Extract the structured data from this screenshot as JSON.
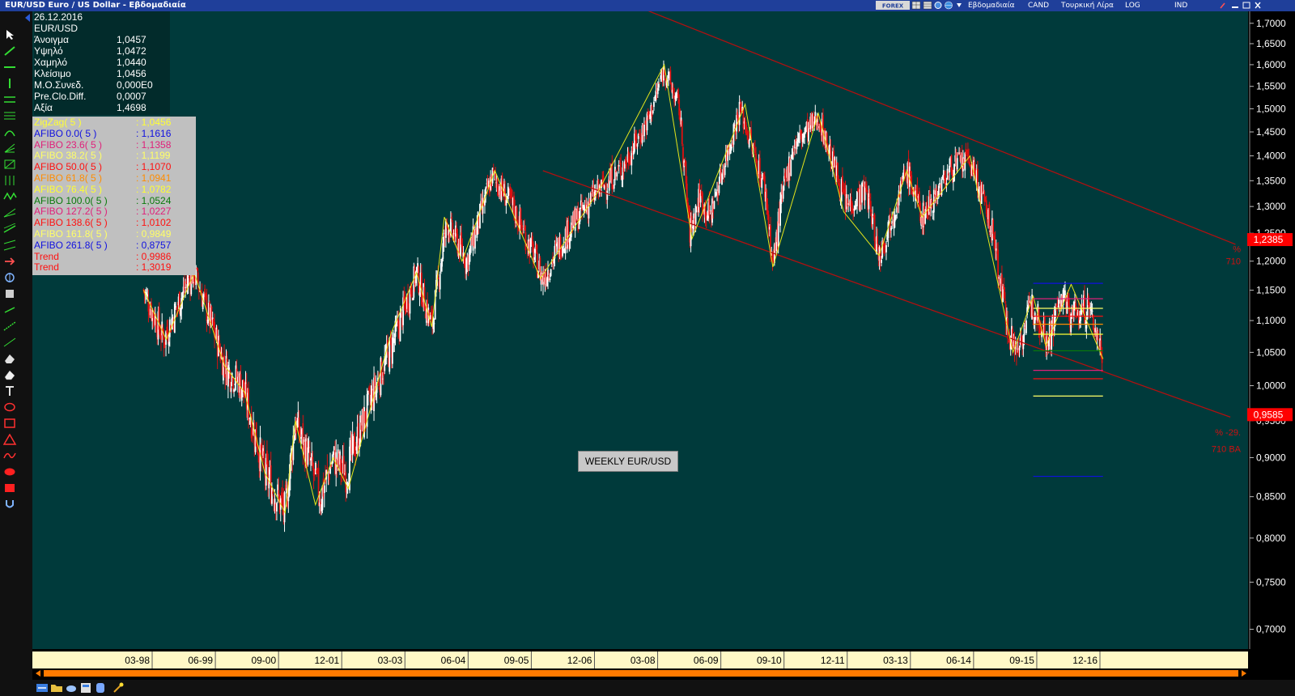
{
  "window": {
    "title": "EUR/USD Euro / US Dollar - Εβδομαδιαία",
    "options": [
      {
        "key": "period",
        "label": "Εβδομαδιαία"
      },
      {
        "key": "style",
        "label": "CAND"
      },
      {
        "key": "currency",
        "label": "Τουρκική Λίρα"
      },
      {
        "key": "scale",
        "label": "LOG"
      },
      {
        "key": "indicators",
        "label": "IND"
      }
    ],
    "brand": "FOREX"
  },
  "info": {
    "date": "26.12.2016",
    "symbol": "EUR/USD",
    "rows": [
      {
        "label": "Άνοιγμα",
        "value": "1,0457"
      },
      {
        "label": "Υψηλό",
        "value": "1,0472"
      },
      {
        "label": "Χαμηλό",
        "value": "1,0440"
      },
      {
        "label": "Κλείσιμο",
        "value": "1,0456"
      },
      {
        "label": "Μ.Ο.Συνεδ.",
        "value": "0,000E0"
      },
      {
        "label": "Pre.Clo.Diff.",
        "value": "0,0007"
      },
      {
        "label": "Αξία",
        "value": "1,4698"
      }
    ]
  },
  "indicators": [
    {
      "label": "ZigZag( 5 )",
      "value": ": 1,0456",
      "color": "#ffff33"
    },
    {
      "label": "AFIBO 0.0( 5 )",
      "value": ": 1,1616",
      "color": "#1010e0"
    },
    {
      "label": "AFIBO 23.6( 5 )",
      "value": ": 1,1358",
      "color": "#e0207a"
    },
    {
      "label": "AFIBO 38.2( 5 )",
      "value": ": 1,1199",
      "color": "#ffff66"
    },
    {
      "label": "AFIBO 50.0( 5 )",
      "value": ": 1,1070",
      "color": "#ff1010"
    },
    {
      "label": "AFIBO 61.8( 5 )",
      "value": ": 1,0941",
      "color": "#ff8c00"
    },
    {
      "label": "AFIBO 76.4( 5 )",
      "value": ": 1,0782",
      "color": "#ffff33"
    },
    {
      "label": "AFIBO 100.0( 5 )",
      "value": ": 1,0524",
      "color": "#0a7a0a"
    },
    {
      "label": "AFIBO 127.2( 5 )",
      "value": ": 1,0227",
      "color": "#e0207a"
    },
    {
      "label": "AFIBO 138.6( 5 )",
      "value": ": 1,0102",
      "color": "#ff1010"
    },
    {
      "label": "AFIBO 161.8( 5 )",
      "value": ": 0,9849",
      "color": "#ffff66"
    },
    {
      "label": "AFIBO 261.8( 5 )",
      "value": ": 0,8757",
      "color": "#1010e0"
    },
    {
      "label": "Trend",
      "value": ": 0,9986",
      "color": "#ff1010"
    },
    {
      "label": "Trend",
      "value": ": 1,3019",
      "color": "#ff1010"
    }
  ],
  "chart_data": {
    "type": "line",
    "symbol": "EUR/USD",
    "y_scale": "log",
    "ylim": [
      0.68,
      1.73
    ],
    "y_ticks": [
      {
        "label": "1,7000",
        "value": 1.7
      },
      {
        "label": "1,6500",
        "value": 1.65
      },
      {
        "label": "1,6000",
        "value": 1.6
      },
      {
        "label": "1,5500",
        "value": 1.55
      },
      {
        "label": "1,5000",
        "value": 1.5
      },
      {
        "label": "1,4500",
        "value": 1.45
      },
      {
        "label": "1,4000",
        "value": 1.4
      },
      {
        "label": "1,3500",
        "value": 1.35
      },
      {
        "label": "1,3000",
        "value": 1.3
      },
      {
        "label": "1,2500",
        "value": 1.25
      },
      {
        "label": "1,2000",
        "value": 1.2
      },
      {
        "label": "1,1500",
        "value": 1.15
      },
      {
        "label": "1,1000",
        "value": 1.1
      },
      {
        "label": "1,0500",
        "value": 1.05
      },
      {
        "label": "1,0000",
        "value": 1.0
      },
      {
        "label": "0,9500",
        "value": 0.95
      },
      {
        "label": "0,9000",
        "value": 0.9
      },
      {
        "label": "0,8500",
        "value": 0.85
      },
      {
        "label": "0,8000",
        "value": 0.8
      },
      {
        "label": "0,7500",
        "value": 0.75
      },
      {
        "label": "0,7000",
        "value": 0.7
      }
    ],
    "x_ticks": [
      {
        "label": "03-98",
        "t": 1998.17
      },
      {
        "label": "06-99",
        "t": 1999.42
      },
      {
        "label": "09-00",
        "t": 2000.67
      },
      {
        "label": "12-01",
        "t": 2001.92
      },
      {
        "label": "03-03",
        "t": 2003.17
      },
      {
        "label": "06-04",
        "t": 2004.42
      },
      {
        "label": "09-05",
        "t": 2005.67
      },
      {
        "label": "12-06",
        "t": 2006.92
      },
      {
        "label": "03-08",
        "t": 2008.17
      },
      {
        "label": "06-09",
        "t": 2009.42
      },
      {
        "label": "09-10",
        "t": 2010.67
      },
      {
        "label": "12-11",
        "t": 2011.92
      },
      {
        "label": "03-13",
        "t": 2013.17
      },
      {
        "label": "06-14",
        "t": 2014.42
      },
      {
        "label": "09-15",
        "t": 2015.67
      },
      {
        "label": "12-16",
        "t": 2016.92
      }
    ],
    "xlim": [
      1995.8,
      2019.85
    ],
    "price_series": [
      [
        1998.0,
        1.15
      ],
      [
        1998.4,
        1.07
      ],
      [
        1998.9,
        1.17
      ],
      [
        1999.0,
        1.18
      ],
      [
        1999.6,
        1.03
      ],
      [
        1999.95,
        1.0
      ],
      [
        2000.4,
        0.88
      ],
      [
        2000.8,
        0.83
      ],
      [
        2001.0,
        0.95
      ],
      [
        2001.5,
        0.85
      ],
      [
        2001.75,
        0.9
      ],
      [
        2002.0,
        0.88
      ],
      [
        2002.5,
        0.98
      ],
      [
        2003.0,
        1.08
      ],
      [
        2003.4,
        1.18
      ],
      [
        2003.7,
        1.09
      ],
      [
        2004.0,
        1.27
      ],
      [
        2004.4,
        1.2
      ],
      [
        2004.9,
        1.36
      ],
      [
        2005.3,
        1.3
      ],
      [
        2005.9,
        1.17
      ],
      [
        2006.3,
        1.24
      ],
      [
        2006.9,
        1.32
      ],
      [
        2007.5,
        1.38
      ],
      [
        2008.0,
        1.48
      ],
      [
        2008.3,
        1.59
      ],
      [
        2008.6,
        1.5
      ],
      [
        2008.8,
        1.25
      ],
      [
        2009.0,
        1.32
      ],
      [
        2009.2,
        1.28
      ],
      [
        2009.8,
        1.5
      ],
      [
        2010.3,
        1.33
      ],
      [
        2010.45,
        1.19
      ],
      [
        2010.6,
        1.3
      ],
      [
        2010.85,
        1.42
      ],
      [
        2011.35,
        1.48
      ],
      [
        2011.9,
        1.3
      ],
      [
        2012.3,
        1.33
      ],
      [
        2012.55,
        1.21
      ],
      [
        2013.1,
        1.37
      ],
      [
        2013.4,
        1.28
      ],
      [
        2014.0,
        1.38
      ],
      [
        2014.35,
        1.39
      ],
      [
        2014.8,
        1.25
      ],
      [
        2015.05,
        1.11
      ],
      [
        2015.25,
        1.05
      ],
      [
        2015.6,
        1.13
      ],
      [
        2015.9,
        1.07
      ],
      [
        2016.15,
        1.14
      ],
      [
        2016.35,
        1.11
      ],
      [
        2016.7,
        1.12
      ],
      [
        2016.98,
        1.0456
      ]
    ],
    "zigzag": [
      [
        1998.0,
        1.15
      ],
      [
        1998.45,
        1.07
      ],
      [
        1999.0,
        1.18
      ],
      [
        1999.6,
        1.03
      ],
      [
        2000.0,
        0.99
      ],
      [
        2000.4,
        0.88
      ],
      [
        2000.8,
        0.83
      ],
      [
        2001.0,
        0.95
      ],
      [
        2001.4,
        0.84
      ],
      [
        2001.75,
        0.9
      ],
      [
        2002.05,
        0.86
      ],
      [
        2002.9,
        1.08
      ],
      [
        2003.4,
        1.18
      ],
      [
        2003.7,
        1.09
      ],
      [
        2003.95,
        1.28
      ],
      [
        2004.3,
        1.2
      ],
      [
        2004.95,
        1.37
      ],
      [
        2005.85,
        1.17
      ],
      [
        2007.0,
        1.33
      ],
      [
        2008.3,
        1.6
      ],
      [
        2008.85,
        1.24
      ],
      [
        2009.9,
        1.51
      ],
      [
        2010.45,
        1.19
      ],
      [
        2011.35,
        1.49
      ],
      [
        2011.85,
        1.29
      ],
      [
        2012.55,
        1.21
      ],
      [
        2013.1,
        1.37
      ],
      [
        2013.4,
        1.28
      ],
      [
        2014.35,
        1.4
      ],
      [
        2015.2,
        1.05
      ],
      [
        2015.6,
        1.14
      ],
      [
        2015.85,
        1.06
      ],
      [
        2016.35,
        1.16
      ],
      [
        2016.98,
        1.04
      ]
    ],
    "trend_lines": [
      {
        "from": [
          2005.9,
          1.37
        ],
        "to": [
          2019.5,
          0.955
        ]
      },
      {
        "from": [
          2005.0,
          1.89
        ],
        "to": [
          2019.6,
          1.23
        ]
      }
    ],
    "afibo_levels": [
      {
        "label": "0.0",
        "value": 1.1616
      },
      {
        "label": "23.6",
        "value": 1.1358
      },
      {
        "label": "38.2",
        "value": 1.1199
      },
      {
        "label": "50.0",
        "value": 1.107
      },
      {
        "label": "61.8",
        "value": 1.0941
      },
      {
        "label": "76.4",
        "value": 1.0782
      },
      {
        "label": "100.0",
        "value": 1.0524
      },
      {
        "label": "127.2",
        "value": 1.0227
      },
      {
        "label": "138.6",
        "value": 1.0102
      },
      {
        "label": "161.8",
        "value": 0.9849
      },
      {
        "label": "261.8",
        "value": 0.8757
      }
    ],
    "afibo_range": [
      2015.6,
      2016.98
    ],
    "price_markers": [
      {
        "label": "1,2385",
        "value": 1.2385
      },
      {
        "label": "0,9585",
        "value": 0.9585
      }
    ],
    "annotations": [
      {
        "text": "%",
        "value": 1.222
      },
      {
        "text": "710",
        "value": 1.2
      },
      {
        "text": "% -29.",
        "value": 0.934
      },
      {
        "text": "710 BA",
        "value": 0.912
      }
    ],
    "label": "WEEKLY EUR/USD"
  },
  "colors": {
    "chart_bg": "#003a3b",
    "zigzag": "#e6e61a",
    "trend": "#b01010",
    "candle_up": "#ffffff",
    "candle_down": "#e01010",
    "marker_bg": "#ff0000",
    "time_axis_bg": "#fff8c6",
    "scroll_track": "#ff7a00"
  }
}
